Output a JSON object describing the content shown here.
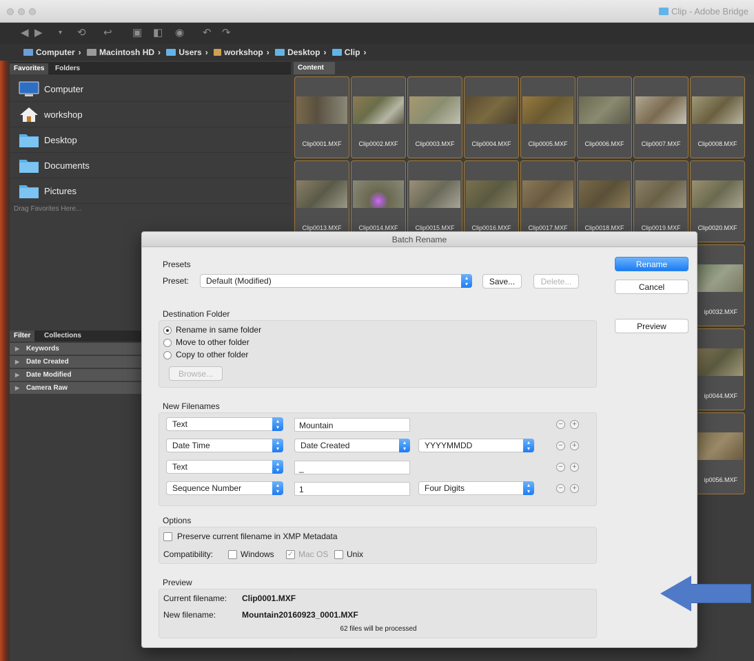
{
  "window": {
    "title": "Clip - Adobe Bridge"
  },
  "path": [
    {
      "label": "Computer",
      "icon": "computer-icon"
    },
    {
      "label": "Macintosh HD",
      "icon": "hard-drive-icon"
    },
    {
      "label": "Users",
      "icon": "folder-icon"
    },
    {
      "label": "workshop",
      "icon": "home-icon"
    },
    {
      "label": "Desktop",
      "icon": "folder-icon"
    },
    {
      "label": "Clip",
      "icon": "folder-icon"
    }
  ],
  "left_tabs": {
    "favorites": "Favorites",
    "folders": "Folders"
  },
  "favorites": [
    {
      "label": "Computer",
      "icon": "computer-icon"
    },
    {
      "label": "workshop",
      "icon": "home-icon"
    },
    {
      "label": "Desktop",
      "icon": "folder-icon"
    },
    {
      "label": "Documents",
      "icon": "folder-icon"
    },
    {
      "label": "Pictures",
      "icon": "folder-icon"
    }
  ],
  "drag_hint": "Drag Favorites Here...",
  "filter_tabs": {
    "filter": "Filter",
    "collections": "Collections"
  },
  "filters": [
    "Keywords",
    "Date Created",
    "Date Modified",
    "Camera Raw"
  ],
  "content_tab": "Content",
  "thumbnails_row1": [
    "Clip0001.MXF",
    "Clip0002.MXF",
    "Clip0003.MXF",
    "Clip0004.MXF",
    "Clip0005.MXF",
    "Clip0006.MXF",
    "Clip0007.MXF",
    "Clip0008.MXF"
  ],
  "thumbnails_row2": [
    "Clip0013.MXF",
    "Clip0014.MXF",
    "Clip0015.MXF",
    "Clip0016.MXF",
    "Clip0017.MXF",
    "Clip0018.MXF",
    "Clip0019.MXF",
    "Clip0020.MXF"
  ],
  "thumbnails_side": [
    "ip0032.MXF",
    "ip0044.MXF",
    "ip0056.MXF"
  ],
  "dialog": {
    "title": "Batch Rename",
    "presets_title": "Presets",
    "preset_label": "Preset:",
    "preset_value": "Default (Modified)",
    "save_label": "Save...",
    "delete_label": "Delete...",
    "rename_label": "Rename",
    "cancel_label": "Cancel",
    "preview_button_label": "Preview",
    "destination_title": "Destination Folder",
    "destinations": [
      "Rename in same folder",
      "Move to other folder",
      "Copy to other folder"
    ],
    "browse_label": "Browse...",
    "new_filenames_title": "New Filenames",
    "rows": [
      {
        "type": "Text",
        "field": "Mountain"
      },
      {
        "type": "Date Time",
        "field": "Date Created",
        "format": "YYYYMMDD"
      },
      {
        "type": "Text",
        "field": "_"
      },
      {
        "type": "Sequence Number",
        "field": "1",
        "format": "Four Digits"
      }
    ],
    "minus_glyph": "−",
    "plus_glyph": "+",
    "options_title": "Options",
    "preserve_label": "Preserve current filename in XMP Metadata",
    "compatibility_label": "Compatibility:",
    "compat": {
      "windows": "Windows",
      "macos": "Mac OS",
      "unix": "Unix"
    },
    "preview_title": "Preview",
    "current_label": "Current filename:",
    "current_value": "Clip0001.MXF",
    "new_label": "New filename:",
    "new_value": "Mountain20160923_0001.MXF",
    "files_processed": "62 files will be processed"
  },
  "colors": {
    "accent": "#1a7cf5",
    "annotation_arrow": "#4f7ac8",
    "thumb_border": "#a07a3b"
  }
}
